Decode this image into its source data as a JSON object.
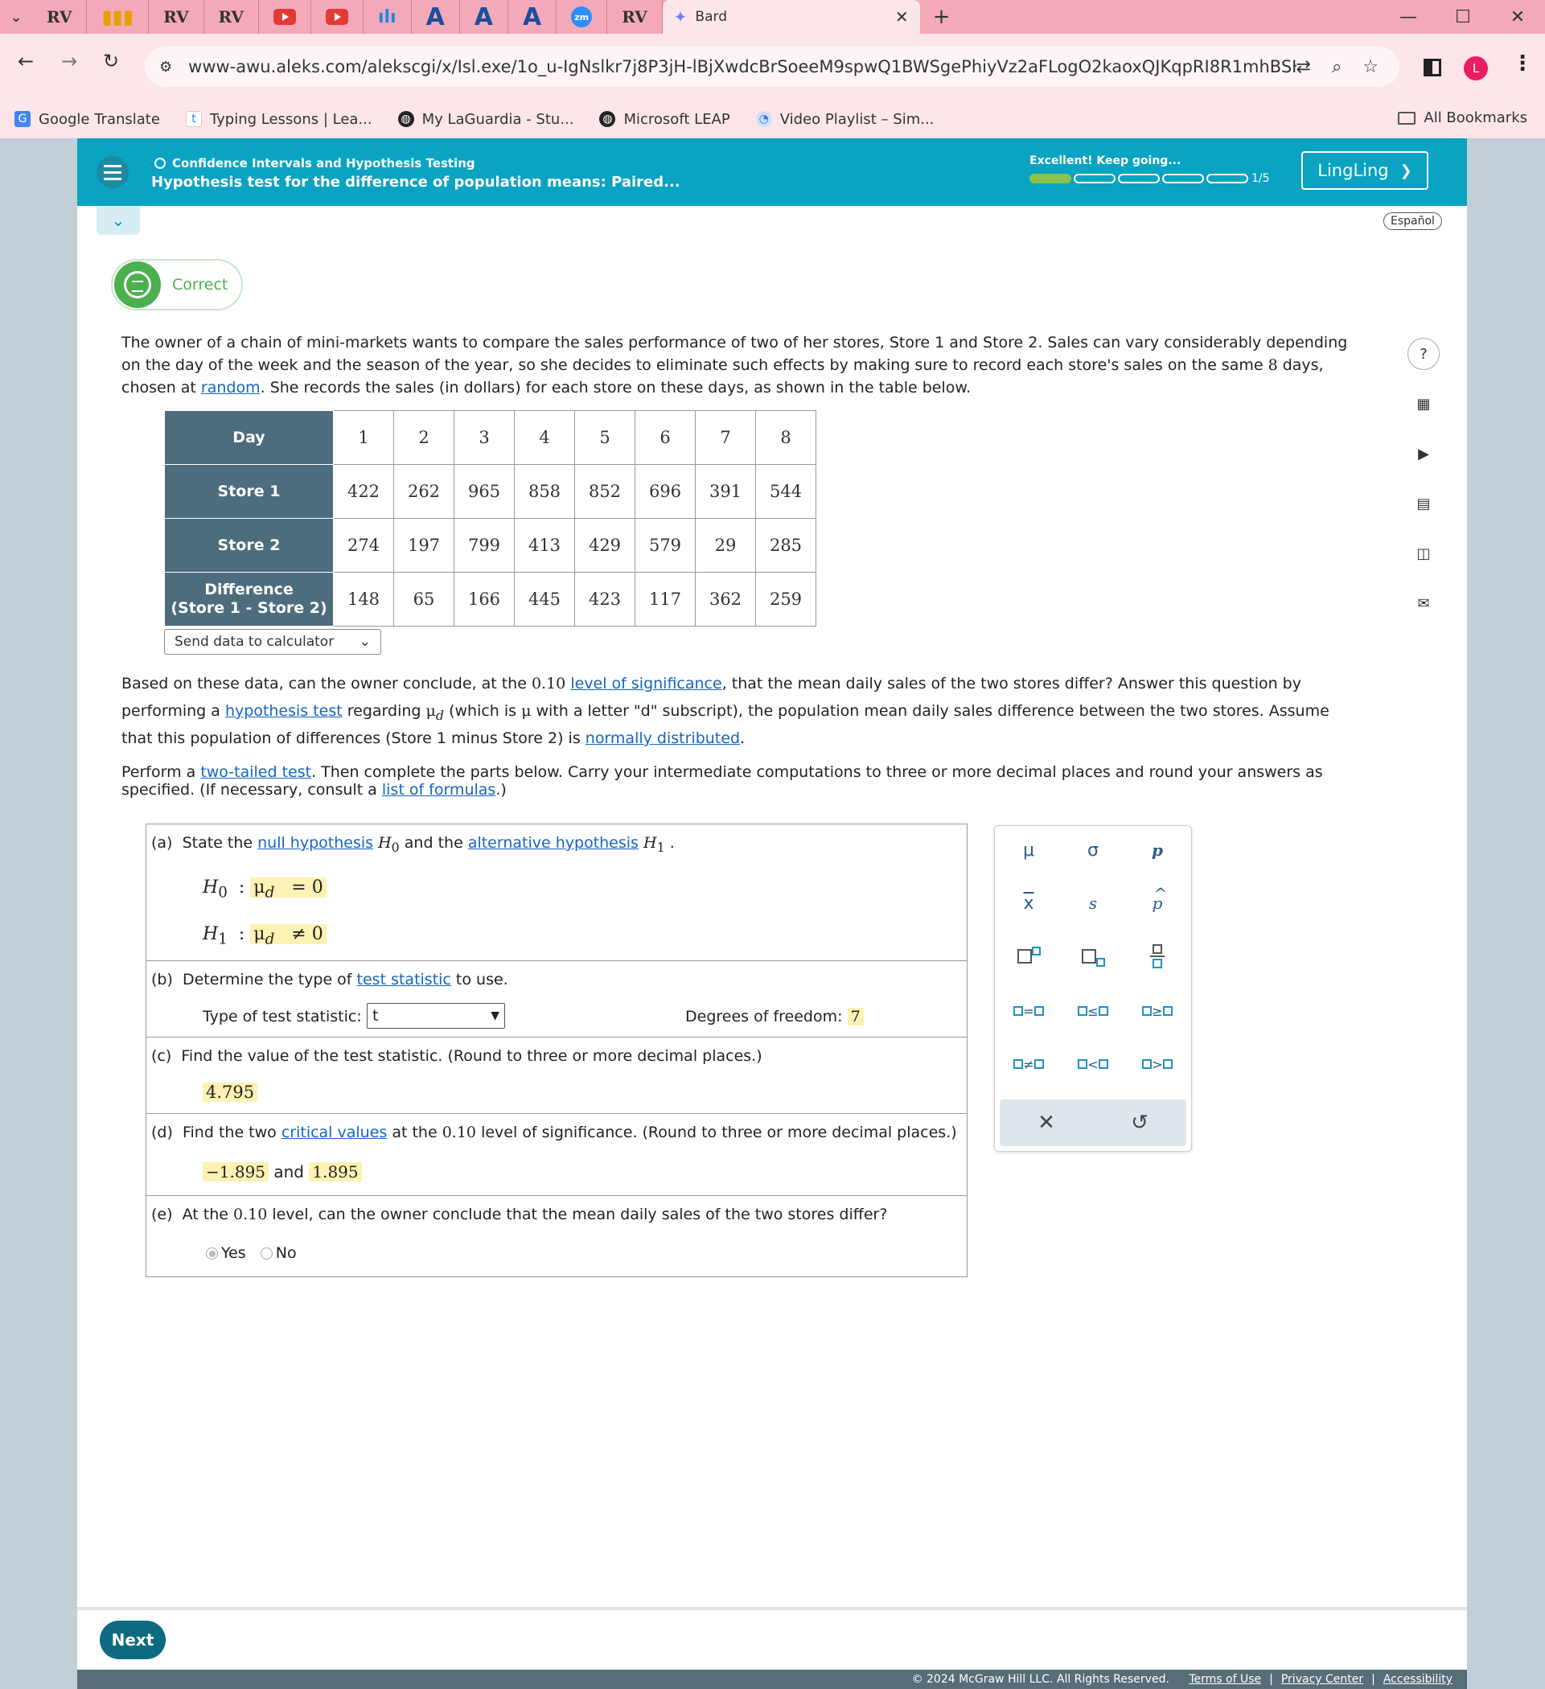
{
  "browser": {
    "active_tab_title": "Bard",
    "url": "www-awu.aleks.com/alekscgi/x/Isl.exe/1o_u-IgNslkr7j8P3jH-lBjXwdcBrSoeeM9spwQ1BWSgePhiyVz2aFLogO2kaoxQJKqpRI8R1mhBSH4pjMzcvv-...",
    "profile_initial": "L",
    "bookmarks": [
      {
        "label": "Google Translate",
        "icon": "google-translate-icon"
      },
      {
        "label": "Typing Lessons | Lea...",
        "icon": "typing-icon"
      },
      {
        "label": "My LaGuardia - Stu...",
        "icon": "globe-icon"
      },
      {
        "label": "Microsoft LEAP",
        "icon": "globe-icon"
      },
      {
        "label": "Video Playlist – Sim...",
        "icon": "playlist-icon"
      }
    ],
    "all_bookmarks": "All Bookmarks"
  },
  "topic": {
    "category": "Confidence Intervals and Hypothesis Testing",
    "title": "Hypothesis test for the difference of population means: Paired...",
    "progress_label": "Excellent! Keep going...",
    "progress_filled": 1,
    "progress_total": 5,
    "progress_count": "1/5",
    "user": "LingLing",
    "language": "Español"
  },
  "status": "Correct",
  "question": {
    "intro": {
      "p1": "The owner of a chain of mini-markets wants to compare the sales performance of two of her stores, Store 1 and Store 2. Sales can vary considerably depending",
      "p2a": "on the day of the week and the season of the year, so she decides to eliminate such effects by making sure to record each store's sales on the same ",
      "p2num": "8",
      "p2b": " days,",
      "p3a": "chosen at ",
      "p3link": "random",
      "p3b": ". She records the sales (in dollars) for each store on these days, as shown in the table below."
    },
    "table": {
      "headers": [
        "Day",
        "Store 1",
        "Store 2"
      ],
      "diff_header_1": "Difference",
      "diff_header_2": "(Store 1 - Store 2)",
      "days": [
        "1",
        "2",
        "3",
        "4",
        "5",
        "6",
        "7",
        "8"
      ],
      "store1": [
        "422",
        "262",
        "965",
        "858",
        "852",
        "696",
        "391",
        "544"
      ],
      "store2": [
        "274",
        "197",
        "799",
        "413",
        "429",
        "579",
        "29",
        "285"
      ],
      "difference": [
        "148",
        "65",
        "166",
        "445",
        "423",
        "117",
        "362",
        "259"
      ]
    },
    "send_data": "Send data to calculator",
    "body1": {
      "a": "Based on these data, can the owner conclude, at the ",
      "alpha": "0.10",
      "link": "level of significance",
      "b": ", that the mean daily sales of the two stores differ? Answer this question by"
    },
    "body2": {
      "a": "performing a ",
      "link": "hypothesis test",
      "b": " regarding ",
      "c": " (which is ",
      "d": " with a letter \"d\" subscript), the population mean daily sales difference between the two stores. Assume"
    },
    "body3": {
      "a": "that this population of differences (Store 1 minus Store 2) is ",
      "link": "normally distributed",
      "b": "."
    },
    "body4": {
      "a": "Perform a ",
      "link": "two-tailed test",
      "b": ". Then complete the parts below. Carry your intermediate computations to three or more decimal places and round your answers as"
    },
    "body5": {
      "a": "specified. (If necessary, consult a ",
      "link": "list of formulas",
      "b": ".)"
    }
  },
  "parts": {
    "a": {
      "label": "(a)",
      "text1": "State the ",
      "link1": "null hypothesis",
      "text2": " and the ",
      "link2": "alternative hypothesis",
      "h0_answer": "= 0",
      "h1_answer": "≠ 0"
    },
    "b": {
      "label": "(b)",
      "text1": "Determine the type of ",
      "link": "test statistic",
      "text2": " to use.",
      "type_label": "Type of test statistic:",
      "type_value": "t",
      "df_label": "Degrees of freedom:",
      "df_value": "7"
    },
    "c": {
      "label": "(c)",
      "text": "Find the value of the test statistic. (Round to three or more decimal places.)",
      "answer": "4.795"
    },
    "d": {
      "label": "(d)",
      "text1": "Find the two ",
      "link": "critical values",
      "text2": " at the ",
      "alpha": "0.10",
      "text3": " level of significance. (Round to three or more decimal places.)",
      "lower": "−1.895",
      "and": "and",
      "upper": "1.895"
    },
    "e": {
      "label": "(e)",
      "text1": "At the ",
      "alpha": "0.10",
      "text2": " level, can the owner conclude that the mean daily sales of the two stores differ?",
      "options": [
        "Yes",
        "No"
      ],
      "selected": "Yes"
    }
  },
  "palette": {
    "mu": "μ",
    "sigma": "σ",
    "p": "p",
    "xbar": "x",
    "s": "s",
    "phat": "p"
  },
  "next": "Next",
  "footer": {
    "copyright": "© 2024 McGraw Hill LLC. All Rights Reserved.",
    "links": [
      "Terms of Use",
      "Privacy Center",
      "Accessibility"
    ]
  },
  "colors": {
    "topic_bar": "#0aa3c2",
    "table_header": "#4d6d7e",
    "answer_highlight": "#fdf2b3",
    "correct_green": "#4caf50",
    "next_button": "#0e6a80"
  }
}
